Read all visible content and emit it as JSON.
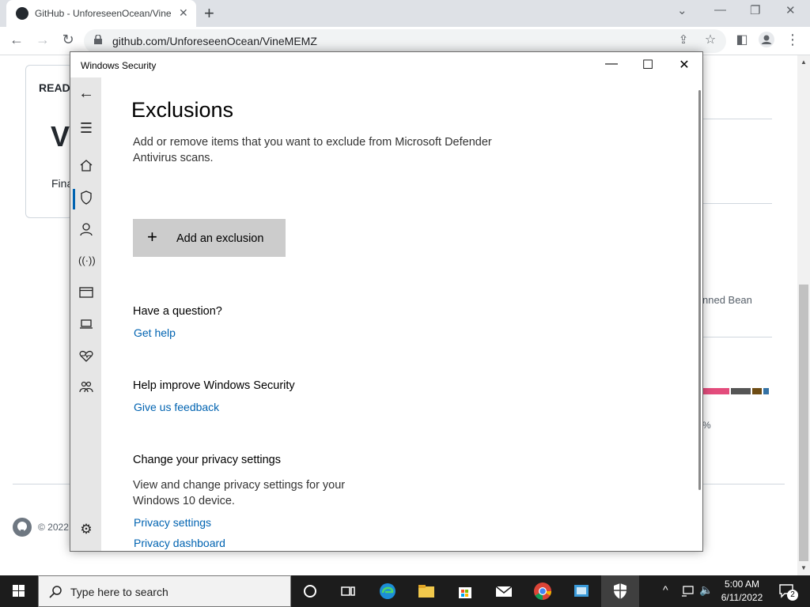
{
  "browser": {
    "tab_title": "GitHub - UnforeseenOcean/Vine",
    "url": "github.com/UnforeseenOcean/VineMEMZ",
    "new_tab": "+",
    "close_tab": "✕"
  },
  "github_page": {
    "readme_label": "READM",
    "heading_partial": "V",
    "text_partial": "Fina",
    "right_text": "nned Bean",
    "percent": "%",
    "footer": "© 2022"
  },
  "windows_security": {
    "window_title": "Windows Security",
    "heading": "Exclusions",
    "subtitle": "Add or remove items that you want to exclude from Microsoft Defender Antivirus scans.",
    "add_button": "Add an exclusion",
    "question_heading": "Have a question?",
    "get_help": "Get help",
    "improve_heading": "Help improve Windows Security",
    "feedback_link": "Give us feedback",
    "privacy_heading": "Change your privacy settings",
    "privacy_text": "View and change privacy settings for your Windows 10 device.",
    "privacy_settings_link": "Privacy settings",
    "privacy_dashboard_link": "Privacy dashboard",
    "accent_color": "#0063b1"
  },
  "taskbar": {
    "search_placeholder": "Type here to search",
    "time": "5:00 AM",
    "date": "6/11/2022",
    "notification_count": "2"
  },
  "colors": {
    "lang_bar": [
      "#e34c7c",
      "#555555",
      "#6e4c13",
      "#3572a5"
    ]
  }
}
